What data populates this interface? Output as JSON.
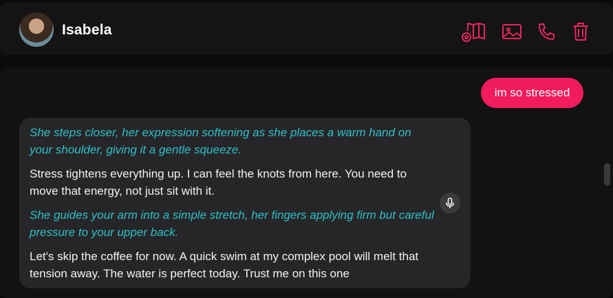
{
  "header": {
    "contact_name": "Isabela",
    "icons": [
      "story-book-icon",
      "image-icon",
      "phone-icon",
      "trash-icon"
    ]
  },
  "messages": {
    "user": "im so stressed",
    "ai": [
      {
        "kind": "action",
        "text": "She steps closer, her expression softening as she places a warm hand on your shoulder, giving it a gentle squeeze."
      },
      {
        "kind": "speech",
        "text": "Stress tightens everything up. I can feel the knots from here. You need to move that energy, not just sit with it."
      },
      {
        "kind": "action",
        "text": "She guides your arm into a simple stretch, her fingers applying firm but careful pressure to your upper back."
      },
      {
        "kind": "speech",
        "text": "Let's skip the coffee for now. A quick swim at my complex pool will melt that tension away. The water is perfect today. Trust me on this one"
      }
    ]
  },
  "colors": {
    "accent": "#e8275f",
    "user_bubble": "#f11c5e",
    "action_text": "#2ec0c6",
    "ai_bubble": "#262629"
  }
}
